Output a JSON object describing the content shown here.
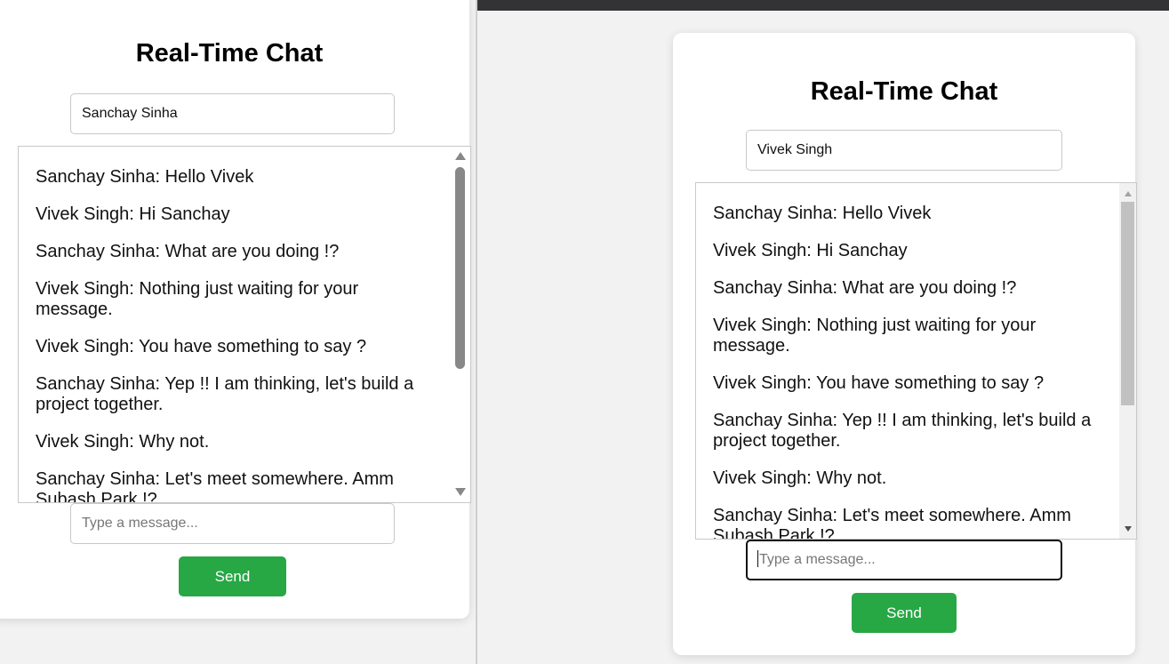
{
  "title": "Real-Time Chat",
  "left_window": {
    "name_value": "Sanchay Sinha",
    "message_placeholder": "Type a message...",
    "send_label": "Send"
  },
  "right_window": {
    "name_value": "Vivek Singh",
    "message_placeholder": "Type a message...",
    "send_label": "Send"
  },
  "messages": [
    "Sanchay Sinha: Hello Vivek",
    "Vivek Singh: Hi Sanchay",
    "Sanchay Sinha: What are you doing !?",
    "Vivek Singh: Nothing just waiting for your message.",
    "Vivek Singh: You have something to say ?",
    "Sanchay Sinha: Yep !! I am thinking, let's build a project together.",
    "Vivek Singh: Why not.",
    "Sanchay Sinha: Let's meet somewhere. Amm Subash Park !?"
  ],
  "colors": {
    "send_button": "#28a745",
    "page_background": "#f2f2f2",
    "card_background": "#ffffff"
  },
  "icons": [
    "scroll-up-arrow-icon",
    "scroll-down-arrow-icon"
  ]
}
